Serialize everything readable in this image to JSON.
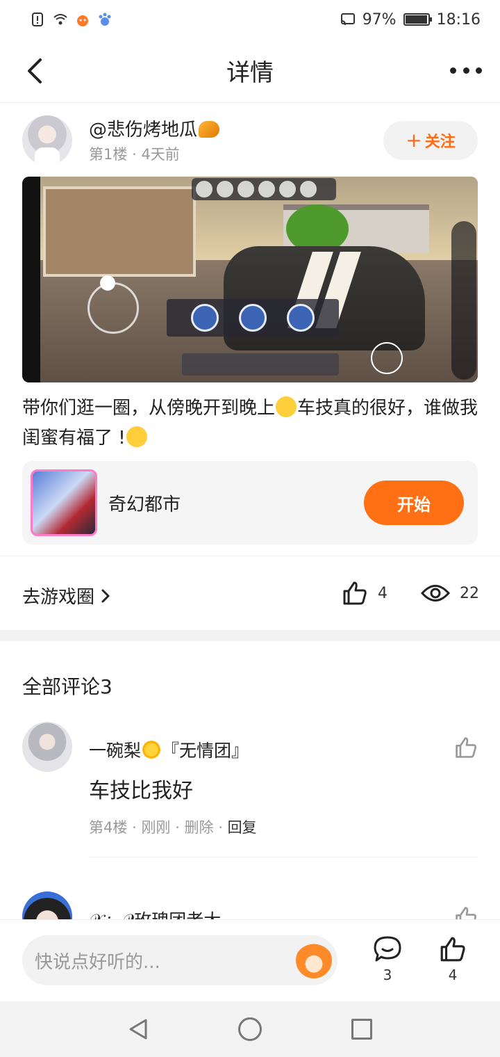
{
  "status_bar": {
    "battery_percent": "97%",
    "battery_level": 0.97,
    "time": "18:16"
  },
  "header": {
    "title": "详情"
  },
  "post": {
    "author": "@悲伤烤地瓜",
    "floor": "第1楼",
    "separator": "·",
    "time_ago": "4天前",
    "follow_plus": "+",
    "follow_label": "关注",
    "text_part1": "带你们逛一圈，从傍晚开到晚上",
    "text_part2": "车技真的很好，谁做我闺蜜有福了 !",
    "game": {
      "name": "奇幻都市",
      "start_label": "开始"
    },
    "circle_link": "去游戏圈",
    "likes": "4",
    "views": "22"
  },
  "comments": {
    "title": "全部评论3",
    "items": [
      {
        "name_part1": "一碗梨",
        "name_part2": "『无情团』",
        "text": "车技比我好",
        "floor": "第4楼",
        "sep1": "·",
        "time": "刚刚",
        "sep2": "·",
        "delete": "删除",
        "sep3": "·",
        "reply": "回复"
      },
      {
        "name": "𝒳𝒾ₐ 𝒬玫瑰团老大"
      }
    ]
  },
  "bottom_bar": {
    "input_placeholder": "快说点好听的...",
    "comment_count": "3",
    "like_count": "4"
  },
  "colors": {
    "accent": "#ff6f14",
    "follow_text": "#ff6a13",
    "muted_text": "#999999"
  }
}
